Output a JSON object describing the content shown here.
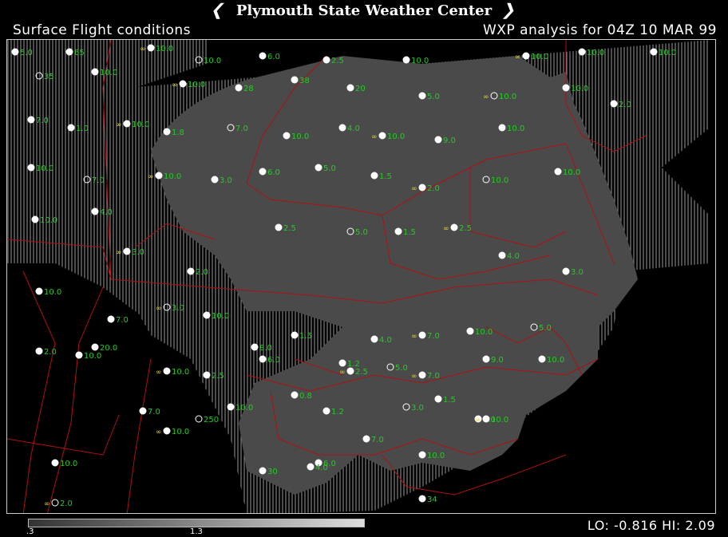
{
  "header": {
    "title": "Plymouth State Weather Center",
    "left_subtitle": "Surface Flight conditions",
    "right_subtitle": "WXP analysis for 04Z 10 MAR 99"
  },
  "colorbar": {
    "low_tick": ".3",
    "high_tick": "1.3"
  },
  "footer": {
    "lo_hi": "LO: -0.816  HI:  2.09"
  },
  "colors": {
    "background": "#000000",
    "shaded_area": "#4a4a4a",
    "hatch": "#9a9a9a",
    "borders": "#b01010",
    "visibility_text": "#22cc22",
    "weather_symbol": "#e0d040"
  },
  "stations": [
    {
      "v": "5.0"
    },
    {
      "v": "65"
    },
    {
      "v": "10.0"
    },
    {
      "v": "10.0"
    },
    {
      "v": "6.0"
    },
    {
      "v": "2.5"
    },
    {
      "v": "10.0"
    },
    {
      "v": "10.0"
    },
    {
      "v": "10.0"
    },
    {
      "v": "10.0"
    },
    {
      "v": "35"
    },
    {
      "v": "10.0"
    },
    {
      "v": "10.0"
    },
    {
      "v": "28"
    },
    {
      "v": "38"
    },
    {
      "v": "20"
    },
    {
      "v": "5.0"
    },
    {
      "v": "10.0"
    },
    {
      "v": "10.0"
    },
    {
      "v": "2.0"
    },
    {
      "v": "7.0"
    },
    {
      "v": "1.0"
    },
    {
      "v": "10.0"
    },
    {
      "v": "1.8"
    },
    {
      "v": "7.0"
    },
    {
      "v": "10.0"
    },
    {
      "v": "4.0"
    },
    {
      "v": "10.0"
    },
    {
      "v": "9.0"
    },
    {
      "v": "10.0"
    },
    {
      "v": "10.0"
    },
    {
      "v": "7.0"
    },
    {
      "v": "10.0"
    },
    {
      "v": "3.0"
    },
    {
      "v": "6.0"
    },
    {
      "v": "5.0"
    },
    {
      "v": "1.5"
    },
    {
      "v": "2.0"
    },
    {
      "v": "10.0"
    },
    {
      "v": "10.0"
    },
    {
      "v": "10.0"
    },
    {
      "v": "4.0"
    },
    {
      "v": "3.0"
    },
    {
      "v": "2.0"
    },
    {
      "v": "2.5"
    },
    {
      "v": "5.0"
    },
    {
      "v": "1.5"
    },
    {
      "v": "2.5"
    },
    {
      "v": "4.0"
    },
    {
      "v": "3.0"
    },
    {
      "v": "10.0"
    },
    {
      "v": "7.0"
    },
    {
      "v": "3.0"
    },
    {
      "v": "10.0"
    },
    {
      "v": "8.0"
    },
    {
      "v": "1.5"
    },
    {
      "v": "4.0"
    },
    {
      "v": "7.0"
    },
    {
      "v": "10.0"
    },
    {
      "v": "5.0"
    },
    {
      "v": "2.0"
    },
    {
      "v": "10.0"
    },
    {
      "v": "10.0"
    },
    {
      "v": "2.5"
    },
    {
      "v": "6.0"
    },
    {
      "v": "1.2"
    },
    {
      "v": "5.0"
    },
    {
      "v": "7.0"
    },
    {
      "v": "9.0"
    },
    {
      "v": "10.0"
    },
    {
      "v": "0.8"
    },
    {
      "v": "1.2"
    },
    {
      "v": "2.5"
    },
    {
      "v": "3.0"
    },
    {
      "v": "1.5"
    },
    {
      "v": "2.0"
    },
    {
      "v": "7.0"
    },
    {
      "v": "10.0"
    },
    {
      "v": "6.0"
    },
    {
      "v": "10.0"
    },
    {
      "v": "250"
    },
    {
      "v": "10.0"
    },
    {
      "v": "10.0"
    },
    {
      "v": "20.0"
    },
    {
      "v": "7.0"
    },
    {
      "v": "4.0"
    },
    {
      "v": "10.0"
    },
    {
      "v": "2.0"
    },
    {
      "v": "30"
    },
    {
      "v": "34"
    }
  ]
}
